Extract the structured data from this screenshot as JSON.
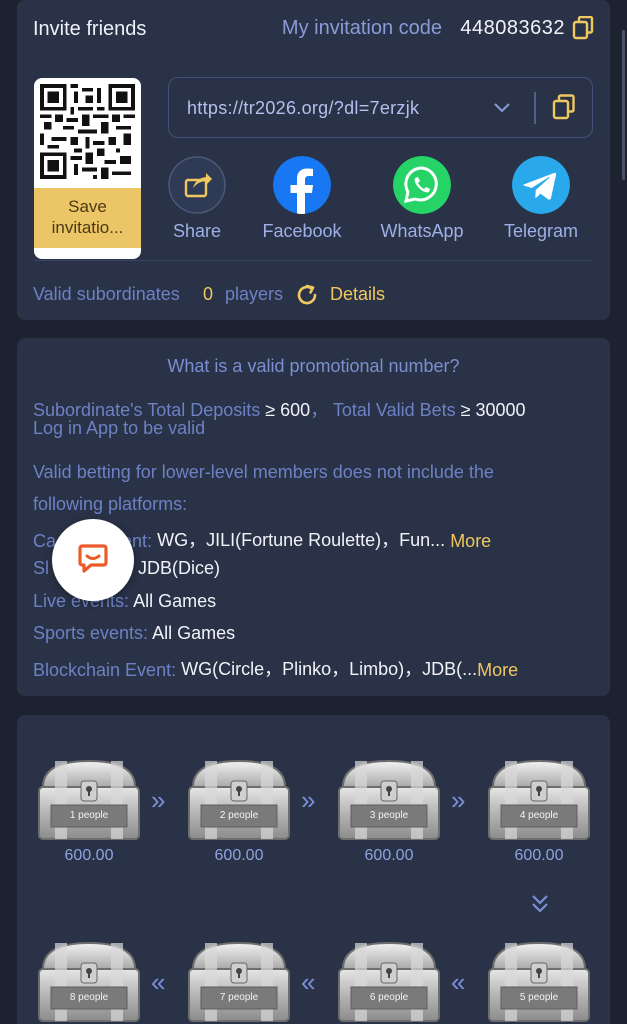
{
  "invite": {
    "title": "Invite friends",
    "code_label": "My invitation code",
    "code_value": "448083632",
    "save_label": "Save invitatio...",
    "url": "https://tr2026.org/?dl=7erzjk",
    "share": [
      {
        "label": "Share",
        "icon": "share-icon"
      },
      {
        "label": "Facebook",
        "icon": "facebook-icon",
        "color": "#1877f2"
      },
      {
        "label": "WhatsApp",
        "icon": "whatsapp-icon",
        "color": "#25d366"
      },
      {
        "label": "Telegram",
        "icon": "telegram-icon",
        "color": "#29a9eb"
      }
    ],
    "subordinates_label": "Valid subordinates",
    "subordinates_count": "0",
    "subordinates_unit": "players",
    "details_label": "Details"
  },
  "rules": {
    "title": "What is a valid promotional number?",
    "deposits_label": "Subordinate's Total Deposits",
    "deposits_value": "≥ 600",
    "bets_label": "Total Valid Bets",
    "bets_value": "≥ 30000",
    "login_note": "Log in App to be valid",
    "exclusion_line1": "Valid betting for lower-level members does not include the",
    "exclusion_line2": "following platforms:",
    "casino_label": "Ca      e Event:",
    "casino_value": "WG，JILI(Fortune Roulette)，Fun...",
    "slot_label": "Sl",
    "slot_value": "JDB(Dice)",
    "live_label": "Live events:",
    "live_value": "All Games",
    "sports_label": "Sports events:",
    "sports_value": "All Games",
    "blockchain_label": "Blockchain Event:",
    "blockchain_value": "WG(Circle，Plinko，Limbo)，JDB(...",
    "more_label": "More"
  },
  "chests": {
    "row1": [
      {
        "label": "1 people",
        "reward": "600.00"
      },
      {
        "label": "2 people",
        "reward": "600.00"
      },
      {
        "label": "3 people",
        "reward": "600.00"
      },
      {
        "label": "4 people",
        "reward": "600.00"
      }
    ],
    "row2": [
      {
        "label": "8 people"
      },
      {
        "label": "7 people"
      },
      {
        "label": "6 people"
      },
      {
        "label": "5 people"
      }
    ],
    "arrow_right": "»",
    "arrow_left": "«"
  },
  "colors": {
    "accent": "#f0c860",
    "label_blue": "#6d81c4",
    "card_bg": "#293246",
    "page_bg": "#1c2230"
  }
}
